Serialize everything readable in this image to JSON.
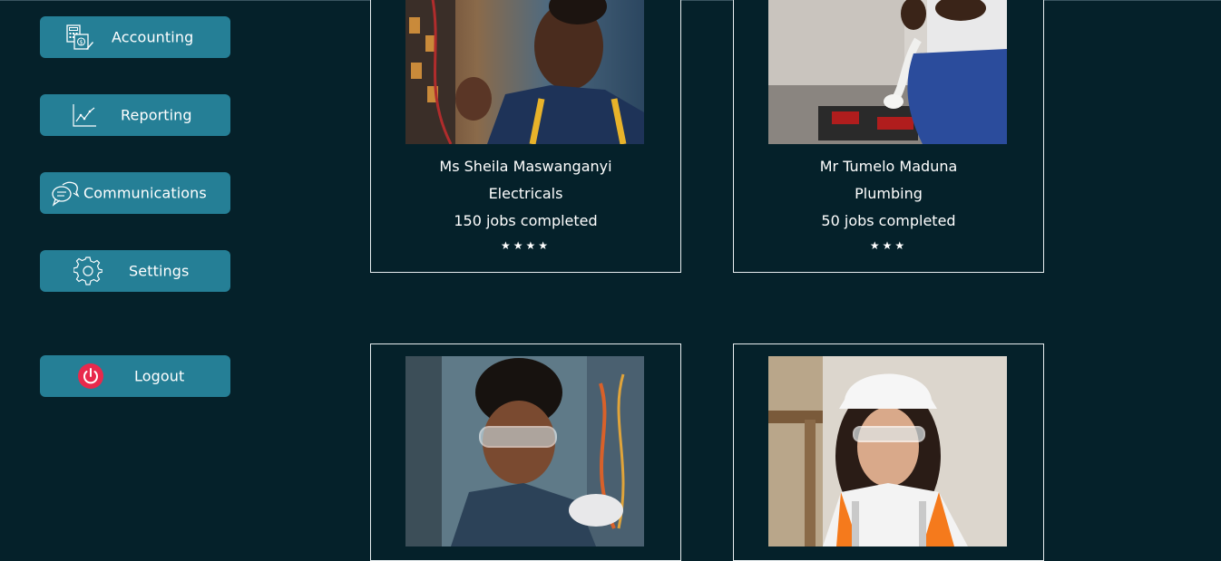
{
  "sidebar": {
    "items": [
      {
        "label": "Accounting",
        "icon": "accounting-icon"
      },
      {
        "label": "Reporting",
        "icon": "chart-icon"
      },
      {
        "label": "Communications",
        "icon": "chat-icon"
      },
      {
        "label": "Settings",
        "icon": "gear-icon"
      }
    ],
    "logout": {
      "label": "Logout",
      "icon": "power-icon"
    }
  },
  "cards": [
    {
      "name": "Ms Sheila Maswanganyi",
      "trade": "Electricals",
      "jobs": "150 jobs completed",
      "stars": "★★★★",
      "rating": 4
    },
    {
      "name": "Mr Tumelo Maduna",
      "trade": "Plumbing",
      "jobs": "50 jobs completed",
      "stars": "★★★",
      "rating": 3
    },
    {
      "name": "",
      "trade": "",
      "jobs": "",
      "stars": "",
      "rating": null
    },
    {
      "name": "",
      "trade": "",
      "jobs": "",
      "stars": "",
      "rating": null
    }
  ],
  "colors": {
    "background": "#05212a",
    "button": "#257f96",
    "logout_icon": "#e8294c",
    "card_border": "#e8eef0"
  }
}
